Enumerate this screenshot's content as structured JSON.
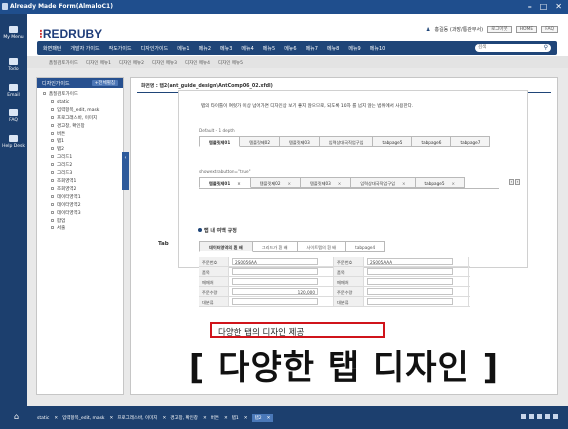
{
  "window": {
    "title": "Already Made Form(AlmaloC1)",
    "controls": [
      "–",
      "□",
      "✕"
    ]
  },
  "rail": [
    {
      "icon": "my-menu-icon",
      "label": "My Menu"
    },
    {
      "icon": "todo-icon",
      "label": "Todo"
    },
    {
      "icon": "email-icon",
      "label": "Email"
    },
    {
      "icon": "faq-icon",
      "label": "FAQ"
    },
    {
      "icon": "help-desk-icon",
      "label": "Help Desk"
    }
  ],
  "header": {
    "logo_mark": "⁝",
    "logo_text": "REDRUBY",
    "user": "홍길동 (과장/통관부서)",
    "user_buttons": [
      "로그아웃",
      "HOME",
      "FAQ"
    ],
    "nav_items": [
      "화면패턴",
      "개발자 가이드",
      "작도가이드",
      "디자인가이드",
      "메뉴1",
      "메뉴2",
      "메뉴3",
      "메뉴4",
      "메뉴5",
      "메뉴6",
      "메뉴7",
      "메뉴8",
      "메뉴9",
      "메뉴10"
    ],
    "search_placeholder": "검색",
    "sub_items": [
      "품질검토가이드",
      "디자인 메뉴1",
      "디자인 메뉴2",
      "디자인 메뉴3",
      "디자인 메뉴4",
      "디자인 메뉴5"
    ]
  },
  "sidebar": {
    "title": "디자인가이드",
    "button": "+전체펼침",
    "tree": [
      {
        "level": 0,
        "label": "품질검토가이드"
      },
      {
        "level": 1,
        "label": "static"
      },
      {
        "level": 1,
        "label": "입력항목_edit, mask"
      },
      {
        "level": 1,
        "label": "프로그래스바, 이미지"
      },
      {
        "level": 1,
        "label": "경고창, 확인창"
      },
      {
        "level": 1,
        "label": "버튼"
      },
      {
        "level": 1,
        "label": "탭1"
      },
      {
        "level": 1,
        "label": "탭2"
      },
      {
        "level": 1,
        "label": "그리드1"
      },
      {
        "level": 1,
        "label": "그리드2"
      },
      {
        "level": 1,
        "label": "그리드3"
      },
      {
        "level": 1,
        "label": "조회영역1"
      },
      {
        "level": 1,
        "label": "조회영역2"
      },
      {
        "level": 1,
        "label": "데이터영역1"
      },
      {
        "level": 1,
        "label": "데이터영역2"
      },
      {
        "level": 1,
        "label": "데이터영역3"
      },
      {
        "level": 1,
        "label": "팝업"
      },
      {
        "level": 1,
        "label": "서줄"
      }
    ],
    "collapse_label": "‹"
  },
  "content": {
    "path": "화면명 : 탭2(ant_guide_design\\AntComp06_02.xfdl)",
    "description": "탭의 타이틀이 여럿가 이상 넘어가면 디자인상 보기 좋지 않으므로, 되도록 10자 를 넘지 않는 범위에서 사용한다.",
    "default_label": "Default - 1 depth",
    "tabs1": [
      "템플릿제01",
      "템플릿제02",
      "템플릿제03",
      "입력상대국직업구입",
      "tabpage5",
      "tabpage6",
      "tabpage7"
    ],
    "showextra_label": "showextrabutton=\"true\"",
    "tabs2": [
      "템플릿제01",
      "템플릿제02",
      "템플릿제03",
      "입력상대국직업구입",
      "tabpage5"
    ],
    "tab_side_label": "Tab",
    "section_title": "탭 내 여백 규정",
    "tabs3": [
      "데이터영역의 흰 배",
      "그리드가 흰 배",
      "사이트맵의 흰 배",
      "tabpage4"
    ],
    "form_rows": [
      [
        "주문번호",
        "2S0056AA",
        "주문번호",
        "2S005AAA"
      ],
      [
        "품목",
        "",
        "품목",
        ""
      ],
      [
        "매매처",
        "",
        "매매처",
        ""
      ],
      [
        "주문수량",
        "120,000",
        "주문수량",
        ""
      ],
      [
        "대분류",
        "",
        "대분류",
        ""
      ]
    ],
    "callout": "다양한 탭의 디자인 제공",
    "caption": "[ 다양한 탭 디자인 ]"
  },
  "taskbar": {
    "home_icon": "⌂",
    "tasks": [
      "static",
      "입력항목_edit, mask",
      "프로그래스바, 이미지",
      "경고창, 확인창",
      "버튼",
      "탭1",
      "탭2"
    ],
    "active": "탭2"
  }
}
